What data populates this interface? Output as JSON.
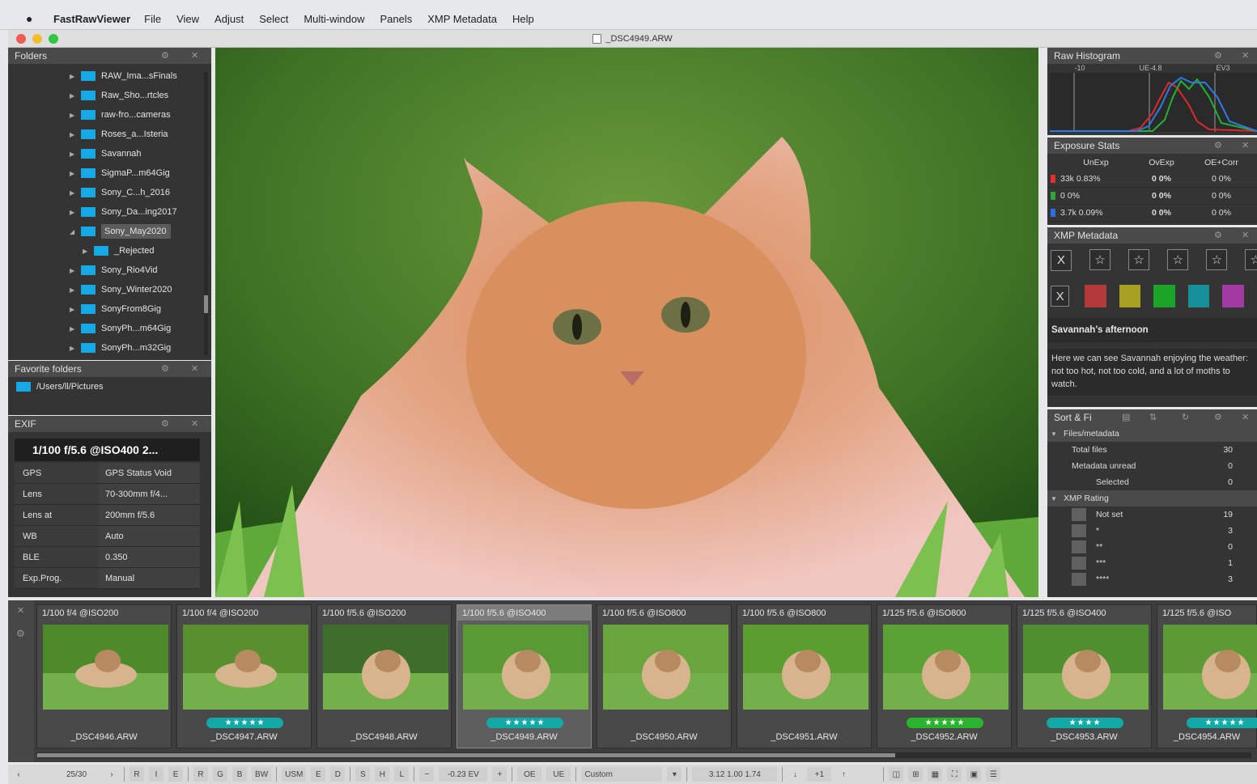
{
  "menubar": {
    "app": "FastRawViewer",
    "items": [
      "File",
      "View",
      "Adjust",
      "Select",
      "Multi-window",
      "Panels",
      "XMP Metadata",
      "Help"
    ]
  },
  "window": {
    "title": "_DSC4949.ARW"
  },
  "folders": {
    "title": "Folders",
    "items": [
      {
        "label": "RAW_Ima...sFinals",
        "sel": false,
        "indent": 0
      },
      {
        "label": "Raw_Sho...rtcles",
        "sel": false,
        "indent": 0
      },
      {
        "label": "raw-fro...cameras",
        "sel": false,
        "indent": 0
      },
      {
        "label": "Roses_a...Isteria",
        "sel": false,
        "indent": 0
      },
      {
        "label": "Savannah",
        "sel": false,
        "indent": 0
      },
      {
        "label": "SigmaP...m64Gig",
        "sel": false,
        "indent": 0
      },
      {
        "label": "Sony_C...h_2016",
        "sel": false,
        "indent": 0
      },
      {
        "label": "Sony_Da...ing2017",
        "sel": false,
        "indent": 0
      },
      {
        "label": "Sony_May2020",
        "sel": true,
        "indent": 0
      },
      {
        "label": "_Rejected",
        "sel": false,
        "indent": 1
      },
      {
        "label": "Sony_Rio4Vid",
        "sel": false,
        "indent": 0
      },
      {
        "label": "Sony_Winter2020",
        "sel": false,
        "indent": 0
      },
      {
        "label": "SonyFrom8Gig",
        "sel": false,
        "indent": 0
      },
      {
        "label": "SonyPh...m64Gig",
        "sel": false,
        "indent": 0
      },
      {
        "label": "SonyPh...m32Gig",
        "sel": false,
        "indent": 0
      }
    ]
  },
  "favorites": {
    "title": "Favorite folders",
    "items": [
      "/Users/ll/Pictures"
    ]
  },
  "exif": {
    "title": "EXIF",
    "summary": "1/100 f/5.6 @ISO400 2...",
    "rows": [
      {
        "k": "GPS",
        "v": "GPS Status Void"
      },
      {
        "k": "Lens",
        "v": "70-300mm f/4..."
      },
      {
        "k": "Lens at",
        "v": "200mm f/5.6"
      },
      {
        "k": "WB",
        "v": "Auto"
      },
      {
        "k": "BLE",
        "v": "0.350"
      },
      {
        "k": "Exp.Prog.",
        "v": "Manual"
      }
    ]
  },
  "histogram": {
    "title": "Raw Histogram",
    "labels": [
      "-10",
      "UE-4.8",
      "EV3"
    ]
  },
  "exposure": {
    "title": "Exposure Stats",
    "headers": [
      "UnExp",
      "OvExp",
      "OE+Corr"
    ],
    "rows": [
      {
        "color": "#e03030",
        "un": "33k 0.83%",
        "ov": "0 0%",
        "oe": "0 0%"
      },
      {
        "color": "#2fa63a",
        "un": "0 0%",
        "ov": "0 0%",
        "oe": "0 0%"
      },
      {
        "color": "#2d6fe0",
        "un": "3.7k 0.09%",
        "ov": "0 0%",
        "oe": "0 0%"
      }
    ]
  },
  "xmp": {
    "title": "XMP Metadata",
    "reject": "X",
    "stars": [
      "☆",
      "☆",
      "☆",
      "☆",
      "☆"
    ],
    "colors": [
      "#b33a3a",
      "#a8a020",
      "#1aa528",
      "#178f99",
      "#a23aa3"
    ],
    "photo_title": "Savannah's afternoon",
    "description": "Here we can see Savannah enjoying the weather: not too hot, not too cold, and a lot of moths to watch."
  },
  "sortfilter": {
    "title": "Sort & Fi",
    "groups": [
      {
        "label": "Files/metadata",
        "rows": [
          {
            "label": "Total files",
            "count": "30"
          },
          {
            "label": "Metadata unread",
            "count": "0"
          },
          {
            "label": "Selected",
            "count": "0"
          }
        ]
      },
      {
        "label": "XMP Rating",
        "rows": [
          {
            "label": "Not set",
            "count": "19"
          },
          {
            "label": "*",
            "count": "3"
          },
          {
            "label": "**",
            "count": "0"
          },
          {
            "label": "***",
            "count": "1"
          },
          {
            "label": "****",
            "count": "3"
          }
        ]
      }
    ]
  },
  "filmstrip": [
    {
      "cap": "1/100 f/4  @ISO200",
      "file": "_DSC4946.ARW",
      "rating": "",
      "rcolor": "",
      "sel": false
    },
    {
      "cap": "1/100 f/4  @ISO200",
      "file": "_DSC4947.ARW",
      "rating": "★★★★★",
      "rcolor": "#13a9a6",
      "sel": false
    },
    {
      "cap": "1/100 f/5.6  @ISO200",
      "file": "_DSC4948.ARW",
      "rating": "",
      "rcolor": "",
      "sel": false
    },
    {
      "cap": "1/100 f/5.6  @ISO400",
      "file": "_DSC4949.ARW",
      "rating": "★★★★★",
      "rcolor": "#13a9a6",
      "sel": true
    },
    {
      "cap": "1/100 f/5.6  @ISO800",
      "file": "_DSC4950.ARW",
      "rating": "",
      "rcolor": "",
      "sel": false
    },
    {
      "cap": "1/100 f/5.6  @ISO800",
      "file": "_DSC4951.ARW",
      "rating": "",
      "rcolor": "",
      "sel": false
    },
    {
      "cap": "1/125 f/5.6  @ISO800",
      "file": "_DSC4952.ARW",
      "rating": "★★★★★",
      "rcolor": "#2bb32e",
      "sel": false
    },
    {
      "cap": "1/125 f/5.6  @ISO400",
      "file": "_DSC4953.ARW",
      "rating": "★★★★",
      "rcolor": "#13a9a6",
      "sel": false
    },
    {
      "cap": "1/125 f/5.6  @ISO",
      "file": "_DSC4954.ARW",
      "rating": "★★★★★",
      "rcolor": "#13a9a6",
      "sel": false
    }
  ],
  "toolbar": {
    "counter": "25/30",
    "items": [
      "R",
      "I",
      "E",
      "R",
      "G",
      "B",
      "BW",
      "USM",
      "E",
      "D",
      "S",
      "H",
      "L"
    ],
    "ev": "-0.23 EV",
    "oe": "OE",
    "ue": "UE",
    "wb": "Custom",
    "mult": "3.12 1.00 1.74",
    "step": "+1"
  }
}
